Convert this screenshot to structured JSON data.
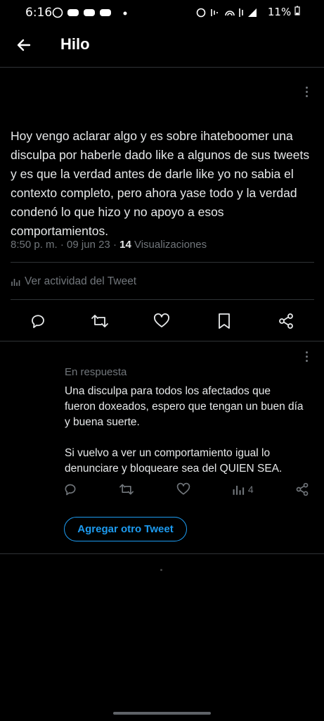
{
  "status_bar": {
    "time": "6:16",
    "battery": "11%"
  },
  "header": {
    "title": "Hilo"
  },
  "tweet": {
    "text": "Hoy vengo aclarar algo y es sobre ihateboomer una disculpa por haberle dado like a algunos de sus tweets y es que la verdad antes de darle like yo no sabia el contexto completo, pero ahora yase todo y la verdad condenó lo que hizo y no apoyo a esos comportamientos.",
    "time": "8:50 p. m.",
    "date": "09 jun 23",
    "views_count": "14",
    "views_label": "Visualizaciones",
    "activity_label": "Ver actividad del Tweet"
  },
  "reply": {
    "label": "En respuesta",
    "text": "Una disculpa para todos los afectados que fueron doxeados, espero que tengan un buen día y buena suerte.\n\nSi vuelvo a ver un comportamiento igual lo denunciare y bloqueare sea del QUIEN SEA.",
    "views_count": "4"
  },
  "add_tweet_label": "Agregar otro Tweet",
  "colors": {
    "accent": "#1d9bf0",
    "muted": "#71767b",
    "text": "#e7e9ea",
    "background": "#000000"
  }
}
